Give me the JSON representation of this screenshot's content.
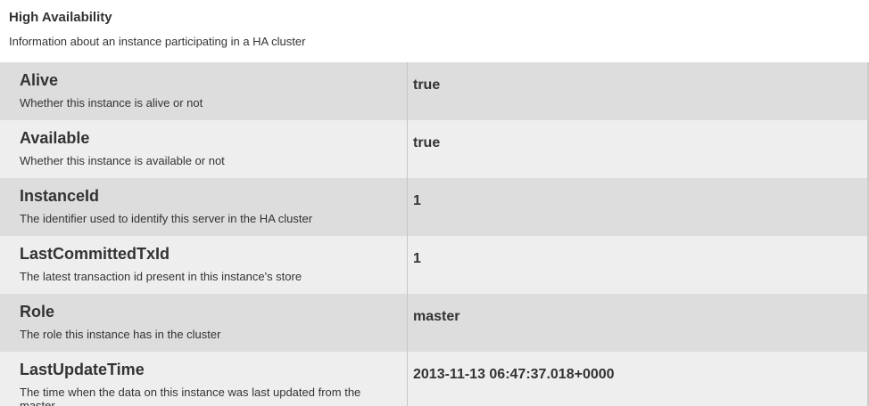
{
  "header": {
    "title": "High Availability",
    "description": "Information about an instance participating in a HA cluster"
  },
  "attributes": [
    {
      "name": "Alive",
      "description": "Whether this instance is alive or not",
      "value": "true"
    },
    {
      "name": "Available",
      "description": "Whether this instance is available or not",
      "value": "true"
    },
    {
      "name": "InstanceId",
      "description": "The identifier used to identify this server in the HA cluster",
      "value": "1"
    },
    {
      "name": "LastCommittedTxId",
      "description": "The latest transaction id present in this instance's store",
      "value": "1"
    },
    {
      "name": "Role",
      "description": "The role this instance has in the cluster",
      "value": "master"
    },
    {
      "name": "LastUpdateTime",
      "description": "The time when the data on this instance was last updated from the master",
      "value": "2013-11-13 06:47:37.018+0000"
    }
  ],
  "colors": {
    "row_dark": "#dddddd",
    "row_light": "#eeeeee",
    "text": "#333333"
  }
}
